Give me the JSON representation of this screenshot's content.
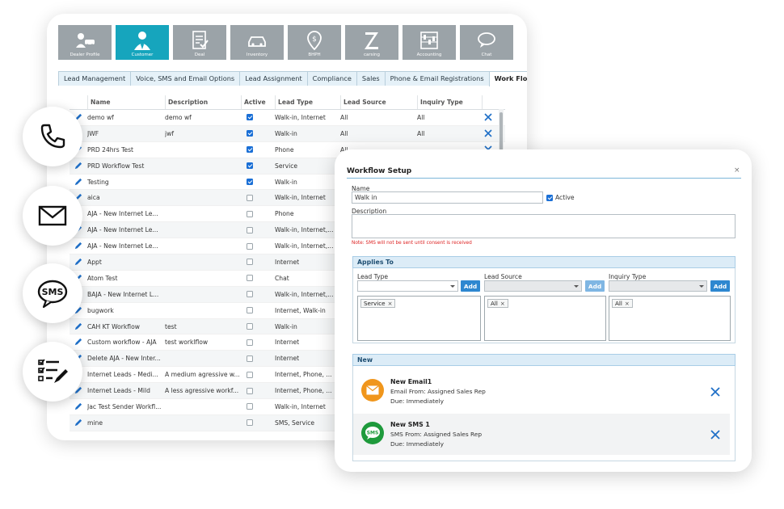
{
  "nav": [
    {
      "label": "Dealer Profile",
      "icon": "dealer-profile-icon",
      "active": false
    },
    {
      "label": "Customer",
      "icon": "customer-icon",
      "active": true
    },
    {
      "label": "Deal",
      "icon": "deal-icon",
      "active": false
    },
    {
      "label": "Inventory",
      "icon": "car-icon",
      "active": false
    },
    {
      "label": "BHPH",
      "icon": "location-dollar-icon",
      "active": false
    },
    {
      "label": "carsing",
      "icon": "carsing-z-icon",
      "active": false
    },
    {
      "label": "Accounting",
      "icon": "abacus-icon",
      "active": false
    },
    {
      "label": "Chat",
      "icon": "chat-icon",
      "active": false
    }
  ],
  "tabs": [
    {
      "label": "Lead Management",
      "active": false
    },
    {
      "label": "Voice, SMS and Email Options",
      "active": false
    },
    {
      "label": "Lead Assignment",
      "active": false
    },
    {
      "label": "Compliance",
      "active": false
    },
    {
      "label": "Sales",
      "active": false
    },
    {
      "label": "Phone & Email Registrations",
      "active": false
    },
    {
      "label": "Work Flow",
      "active": true
    }
  ],
  "grid": {
    "headers": {
      "name": "Name",
      "description": "Description",
      "active": "Active",
      "lead_type": "Lead Type",
      "lead_source": "Lead Source",
      "inquiry_type": "Inquiry Type"
    },
    "rows": [
      {
        "name": "demo wf",
        "description": "demo wf",
        "active": true,
        "lead_type": "Walk-in, Internet",
        "lead_source": "All",
        "inquiry_type": "All",
        "deletable": true
      },
      {
        "name": "JWF",
        "description": "jwf",
        "active": true,
        "lead_type": "Walk-in",
        "lead_source": "All",
        "inquiry_type": "All",
        "deletable": true
      },
      {
        "name": "PRD 24hrs Test",
        "description": "",
        "active": true,
        "lead_type": "Phone",
        "lead_source": "All",
        "inquiry_type": "",
        "deletable": true
      },
      {
        "name": "PRD Workflow Test",
        "description": "",
        "active": true,
        "lead_type": "Service",
        "lead_source": "",
        "inquiry_type": "",
        "deletable": false
      },
      {
        "name": "Testing",
        "description": "",
        "active": true,
        "lead_type": "Walk-in",
        "lead_source": "",
        "inquiry_type": "",
        "deletable": false
      },
      {
        "name": "aica",
        "description": "",
        "active": false,
        "lead_type": "Walk-in, Internet",
        "lead_source": "",
        "inquiry_type": "",
        "deletable": false
      },
      {
        "name": "AJA - New Internet Le...",
        "description": "",
        "active": false,
        "lead_type": "Phone",
        "lead_source": "",
        "inquiry_type": "",
        "deletable": false
      },
      {
        "name": "AJA - New Internet Le...",
        "description": "",
        "active": false,
        "lead_type": "Walk-in, Internet,...",
        "lead_source": "",
        "inquiry_type": "",
        "deletable": false
      },
      {
        "name": "AJA - New Internet Le...",
        "description": "",
        "active": false,
        "lead_type": "Walk-in, Internet,...",
        "lead_source": "",
        "inquiry_type": "",
        "deletable": false
      },
      {
        "name": "Appt",
        "description": "",
        "active": false,
        "lead_type": "Internet",
        "lead_source": "",
        "inquiry_type": "",
        "deletable": false
      },
      {
        "name": "Atom Test",
        "description": "",
        "active": false,
        "lead_type": "Chat",
        "lead_source": "",
        "inquiry_type": "",
        "deletable": false
      },
      {
        "name": "BAJA - New Internet L...",
        "description": "",
        "active": false,
        "lead_type": "Walk-in, Internet,...",
        "lead_source": "",
        "inquiry_type": "",
        "deletable": false
      },
      {
        "name": "bugwork",
        "description": "",
        "active": false,
        "lead_type": "Internet, Walk-in",
        "lead_source": "",
        "inquiry_type": "",
        "deletable": false
      },
      {
        "name": "CAH KT Workflow",
        "description": "test",
        "active": false,
        "lead_type": "Walk-in",
        "lead_source": "",
        "inquiry_type": "",
        "deletable": false
      },
      {
        "name": "Custom workflow - AJA",
        "description": "test worklflow",
        "active": false,
        "lead_type": "Internet",
        "lead_source": "",
        "inquiry_type": "",
        "deletable": false
      },
      {
        "name": "Delete AJA - New Inter...",
        "description": "",
        "active": false,
        "lead_type": "Internet",
        "lead_source": "",
        "inquiry_type": "",
        "deletable": false
      },
      {
        "name": "Internet Leads - Medi...",
        "description": "A medium agressive w...",
        "active": false,
        "lead_type": "Internet, Phone, ...",
        "lead_source": "",
        "inquiry_type": "",
        "deletable": false
      },
      {
        "name": "Internet Leads - Mild",
        "description": "A less agressive workf...",
        "active": false,
        "lead_type": "Internet, Phone, ...",
        "lead_source": "",
        "inquiry_type": "",
        "deletable": false
      },
      {
        "name": "Jac Test Sender Workfl...",
        "description": "",
        "active": false,
        "lead_type": "Walk-in, Internet",
        "lead_source": "",
        "inquiry_type": "",
        "deletable": false
      },
      {
        "name": "mine",
        "description": "",
        "active": false,
        "lead_type": "SMS, Service",
        "lead_source": "",
        "inquiry_type": "",
        "deletable": false
      }
    ]
  },
  "side_icons": [
    "phone-icon",
    "email-envelope-icon",
    "sms-bubble-icon",
    "checklist-pen-icon"
  ],
  "dialog": {
    "title": "Workflow Setup",
    "close": "×",
    "name_label": "Name",
    "name_value": "Walk in",
    "active_label": "Active",
    "description_label": "Description",
    "description_value": "",
    "note": "Note: SMS will not be sent until consent is received",
    "applies_to": {
      "title": "Applies To",
      "lead_type": {
        "label": "Lead Type",
        "chips": [
          "Service"
        ]
      },
      "lead_source": {
        "label": "Lead Source",
        "chips": [
          "All"
        ]
      },
      "inquiry_type": {
        "label": "Inquiry Type",
        "chips": [
          "All"
        ]
      },
      "add_label": "Add"
    },
    "new_section": {
      "title": "New",
      "actions": [
        {
          "title": "New Email1",
          "line1": "Email From: Assigned Sales Rep",
          "line2": "Due: Immediately",
          "icon": "email-circle-icon",
          "color": "#f0961c"
        },
        {
          "title": "New SMS 1",
          "line1": "SMS From: Assigned Sales Rep",
          "line2": "Due: Immediately",
          "icon": "sms-circle-icon",
          "color": "#1e9a3c"
        }
      ]
    }
  },
  "colors": {
    "accent": "#16a5bd",
    "nav_tile": "#9ba3a8",
    "link_blue": "#1f6fc7",
    "add_button": "#2e87d0"
  }
}
